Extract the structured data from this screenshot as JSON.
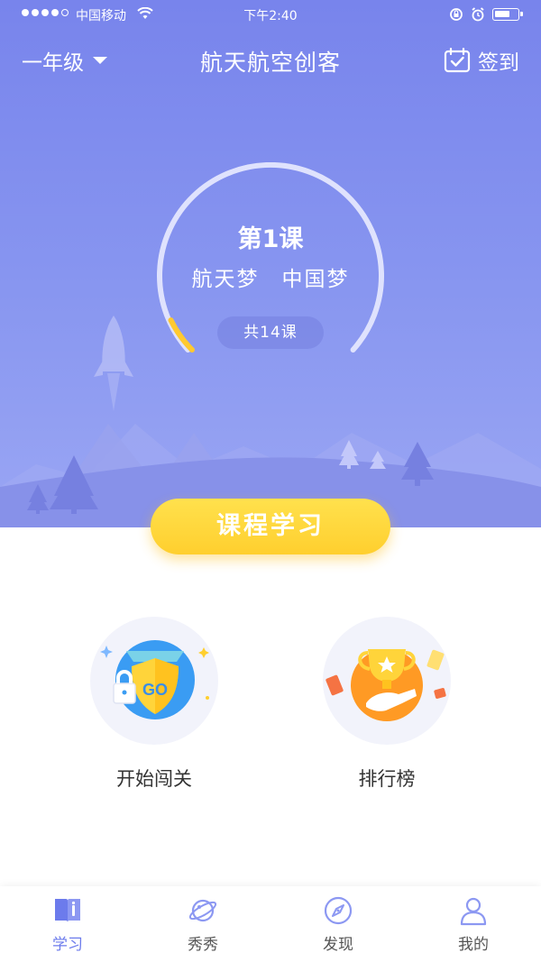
{
  "status_bar": {
    "carrier": "中国移动",
    "time": "下午2:40"
  },
  "nav": {
    "grade": "一年级",
    "title": "航天航空创客",
    "checkin": "签到"
  },
  "lesson": {
    "number": "第1课",
    "title": "航天梦　中国梦",
    "count": "共14课",
    "progress_fraction": 0.07
  },
  "course_button": "课程学习",
  "features": [
    {
      "label": "开始闯关",
      "icon": "go-shield-icon",
      "badge_text": "GO"
    },
    {
      "label": "排行榜",
      "icon": "trophy-icon"
    }
  ],
  "tabs": [
    {
      "label": "学习",
      "icon": "book-icon",
      "active": true
    },
    {
      "label": "秀秀",
      "icon": "planet-icon",
      "active": false
    },
    {
      "label": "发现",
      "icon": "compass-icon",
      "active": false
    },
    {
      "label": "我的",
      "icon": "user-icon",
      "active": false
    }
  ],
  "colors": {
    "primary": "#7884ec",
    "accent_yellow": "#ffd43a",
    "tab_active": "#6c7bec"
  }
}
